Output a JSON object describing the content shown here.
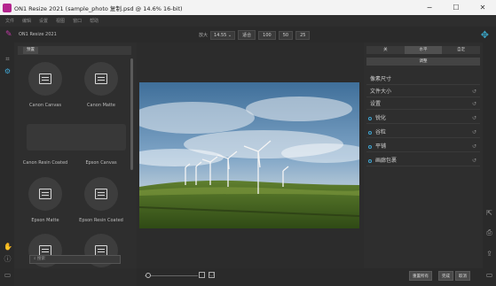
{
  "window": {
    "title": "ON1 Resize 2021 (sample_photo 复制.psd @ 14.6% 16-bit)",
    "minimize": "−",
    "maximize": "☐",
    "close": "✕"
  },
  "menu": [
    "文件",
    "编辑",
    "设置",
    "视图",
    "窗口",
    "帮助"
  ],
  "app": {
    "name": "ON1 Resize 2021",
    "zoom_label": "放大",
    "zoom_value": "14.55",
    "fit_label": "适合",
    "zoom_presets": [
      "100",
      "50",
      "25"
    ]
  },
  "presets": {
    "tab_label": "预置",
    "tiles": [
      {
        "label": "Canon Canvas"
      },
      {
        "label": "Canon Matte"
      },
      {
        "label": "Canon Resin Coated"
      },
      {
        "label": "Epson Canvas"
      },
      {
        "label": "Epson Matte"
      },
      {
        "label": "Epson Resin Coated"
      }
    ],
    "search_placeholder": "搜索"
  },
  "right_panel": {
    "tabs": [
      "关",
      "水平",
      "自定"
    ],
    "active_tab": 1,
    "adjust_button": "调整",
    "rows": [
      {
        "label": "像素尺寸",
        "dot": false,
        "reset": false
      },
      {
        "label": "文件大小",
        "dot": false,
        "reset": true
      },
      {
        "label": "设置",
        "dot": false,
        "reset": true
      },
      {
        "label": "锐化",
        "dot": true,
        "reset": true
      },
      {
        "label": "谷粒",
        "dot": true,
        "reset": true
      },
      {
        "label": "平铺",
        "dot": true,
        "reset": true
      },
      {
        "label": "画廊包裹",
        "dot": true,
        "reset": true
      }
    ]
  },
  "bottom": {
    "reset_all": "重置所有",
    "done": "完成",
    "cancel": "取消"
  },
  "colors": {
    "accent": "#3fa6d4",
    "brand": "#c03aa6"
  }
}
